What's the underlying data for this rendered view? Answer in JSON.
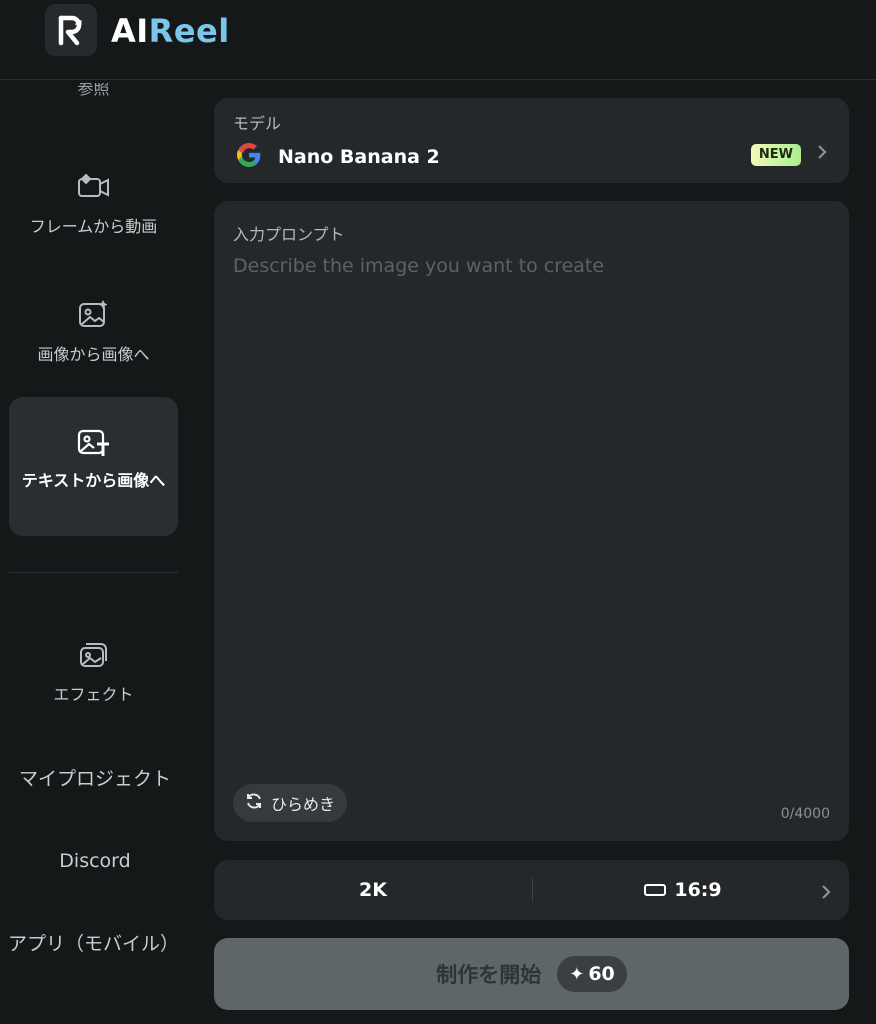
{
  "app": {
    "logo_ai": "AI",
    "logo_reel": "Reel",
    "logo_mark": "R"
  },
  "sidebar": {
    "partial_item": "参照",
    "items": [
      {
        "label": "フレームから動画",
        "icon": "frame-video-icon"
      },
      {
        "label": "画像から画像へ",
        "icon": "image-sparkle-icon"
      },
      {
        "label": "テキストから画像へ",
        "icon": "image-text-icon",
        "active": true
      }
    ],
    "effects": {
      "label": "エフェクト",
      "icon": "gallery-stack-icon"
    },
    "my_projects": "マイプロジェクト",
    "discord": "Discord",
    "app_mobile": "アプリ（モバイル）"
  },
  "model": {
    "label": "モデル",
    "name": "Nano Banana 2",
    "badge": "NEW",
    "provider_icon": "google-icon"
  },
  "prompt": {
    "label": "入力プロンプト",
    "placeholder": "Describe the image you want to create",
    "value": "",
    "counter": "0/4000",
    "inspire_label": "ひらめき"
  },
  "settings": {
    "resolution": "2K",
    "aspect_ratio": "16:9"
  },
  "create": {
    "label": "制作を開始",
    "cost": "60"
  },
  "colors": {
    "background": "#151819",
    "card": "#25282a",
    "accent_reel": "#7cc6ec",
    "new_badge": "#c5f49f",
    "create_button": "#5f6668"
  }
}
